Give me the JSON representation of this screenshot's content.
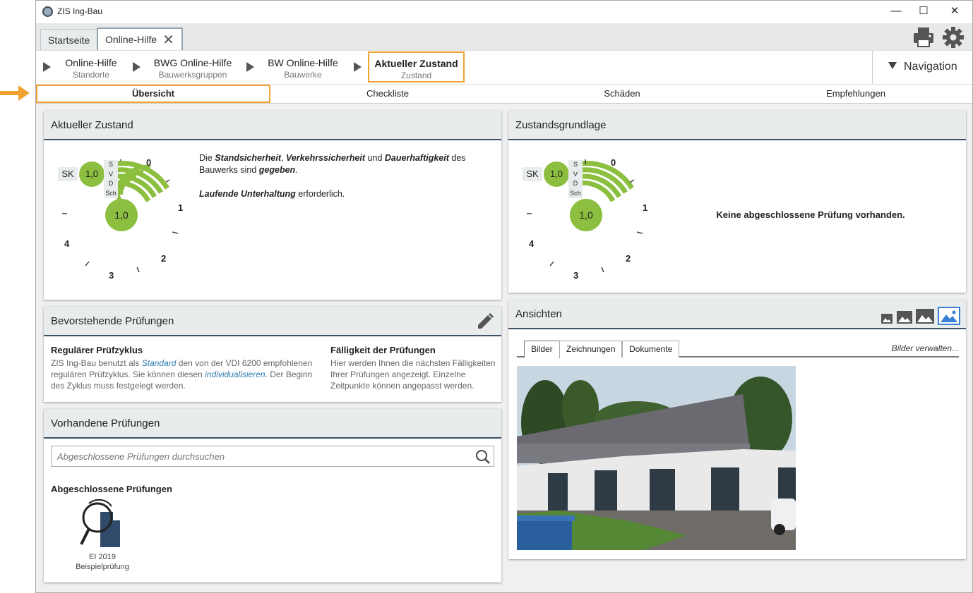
{
  "window": {
    "title": "ZIS Ing-Bau",
    "minimize": "—",
    "maximize": "☐",
    "close": "✕"
  },
  "tabs": [
    {
      "label": "Startseite"
    },
    {
      "label": "Online-Hilfe",
      "close": "✕"
    }
  ],
  "breadcrumb": [
    {
      "title": "Online-Hilfe",
      "sub": "Standorte"
    },
    {
      "title": "BWG Online-Hilfe",
      "sub": "Bauwerksgruppen"
    },
    {
      "title": "BW Online-Hilfe",
      "sub": "Bauwerke"
    },
    {
      "title": "Aktueller Zustand",
      "sub": "Zustand"
    }
  ],
  "navigation_label": "Navigation",
  "subtabs": [
    "Übersicht",
    "Checkliste",
    "Schäden",
    "Empfehlungen"
  ],
  "gauge": {
    "sk_label": "SK",
    "sk_value": "1,0",
    "center_value": "1,0",
    "bands": [
      "S",
      "V",
      "D",
      "Sch"
    ],
    "scale": [
      "0",
      "1",
      "2",
      "3",
      "4"
    ],
    "colors": {
      "green": "#8cbf3f",
      "sk_bg": "#e9ecec"
    }
  },
  "aktueller_zustand": {
    "title": "Aktueller Zustand",
    "p1_a": "Die ",
    "p1_b": "Standsicherheit",
    "p1_c": ", ",
    "p1_d": "Verkehrssicherheit",
    "p1_e": " und ",
    "p1_f": "Dauerhaftigkeit",
    "p1_g": " des Bauwerks sind ",
    "p1_h": "gegeben",
    "p1_i": ".",
    "p2_a": "Laufende Unterhaltung",
    "p2_b": " erforderlich."
  },
  "zustandsgrundlage": {
    "title": "Zustandsgrundlage",
    "message": "Keine abgeschlossene Prüfung vorhanden."
  },
  "bevorstehende": {
    "title": "Bevorstehende Prüfungen",
    "left_title": "Regulärer Prüfzyklus",
    "left_a": "ZIS Ing-Bau benutzt als ",
    "left_link1": "Standard",
    "left_b": " den von der VDI 6200 empfohlenen regulären Prüfzyklus. Sie können diesen ",
    "left_link2": "individualisieren",
    "left_c": ". Der Beginn des Zyklus muss  festgelegt werden.",
    "right_title": "Fälligkeit der Prüfungen",
    "right_text": "Hier werden Ihnen die nächsten Fälligkeiten Ihrer Prüfungen angezeigt. Einzelne Zeitpunkte können angepasst werden."
  },
  "vorhandene": {
    "title": "Vorhandene Prüfungen",
    "search_placeholder": "Abgeschlossene Prüfungen durchsuchen",
    "section": "Abgeschlossene Prüfungen",
    "item_line1": "EI 2019",
    "item_line2": "Beispielprüfung"
  },
  "ansichten": {
    "title": "Ansichten",
    "tabs": [
      "Bilder",
      "Zeichnungen",
      "Dokumente"
    ],
    "manage": "Bilder verwalten..."
  },
  "accent": "#f2a233",
  "header_rule": "#3e5368"
}
